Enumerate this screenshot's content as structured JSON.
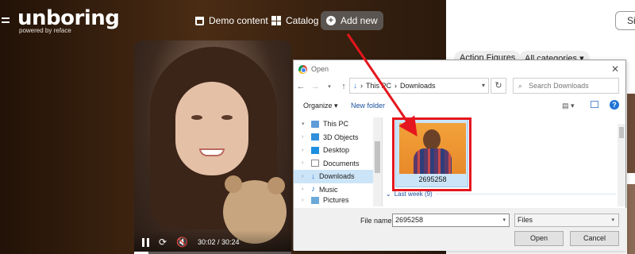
{
  "site": {
    "logo": "unboring",
    "logo_sub": "powered by reface",
    "nav": {
      "demo": "Demo content",
      "catalog": "Catalog",
      "add_new": "Add new"
    },
    "right_button": "Si",
    "chips": [
      "Action Figures",
      "All categories"
    ]
  },
  "video": {
    "time": "30:02 / 30:24",
    "progress": 0.09
  },
  "dialog": {
    "title": "Open",
    "breadcrumb": [
      "This PC",
      "Downloads"
    ],
    "search_placeholder": "Search Downloads",
    "organize": "Organize",
    "new_folder": "New folder",
    "nav_items": [
      {
        "label": "This PC",
        "icon": "pc-icon"
      },
      {
        "label": "3D Objects",
        "icon": "cube-icon"
      },
      {
        "label": "Desktop",
        "icon": "desktop-icon"
      },
      {
        "label": "Documents",
        "icon": "documents-icon"
      },
      {
        "label": "Downloads",
        "icon": "download-icon"
      },
      {
        "label": "Music",
        "icon": "music-icon"
      },
      {
        "label": "Pictures",
        "icon": "pictures-icon"
      }
    ],
    "file": {
      "name": "2695258"
    },
    "group_header": "Last week (9)",
    "file_name_label": "File name:",
    "file_name_value": "2695258",
    "file_type": "Files",
    "open_label": "Open",
    "cancel_label": "Cancel"
  },
  "colors": {
    "annotation_red": "#e5161d",
    "selection_blue": "#cce4f7"
  }
}
